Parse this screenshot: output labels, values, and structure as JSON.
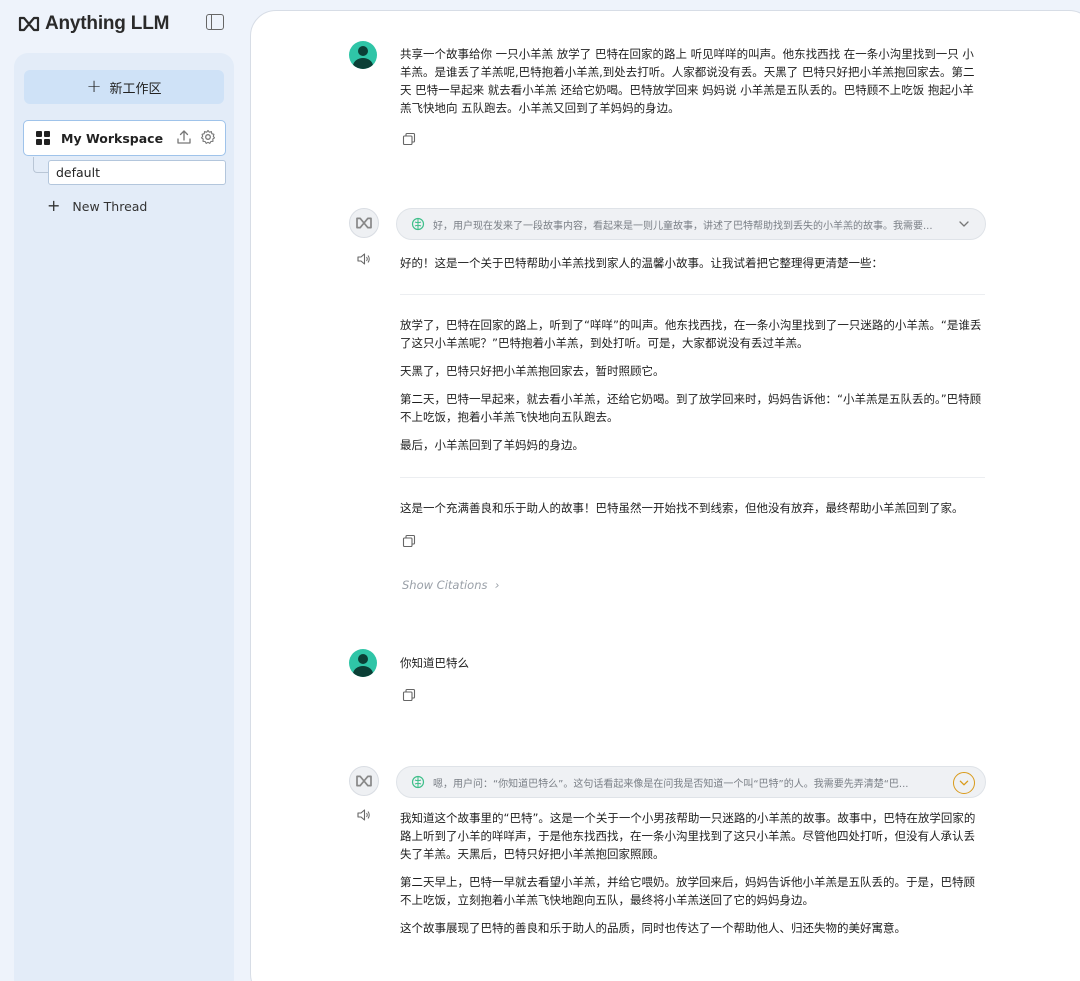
{
  "app": {
    "title": "Anything LLM",
    "brand_color": "#2a2a2a"
  },
  "sidebar": {
    "new_workspace_label": "新工作区",
    "workspace": {
      "label": "My Workspace",
      "icon": "grid-icon"
    },
    "thread": "default",
    "new_thread_label": "New Thread"
  },
  "chat": {
    "messages": [
      {
        "role": "user",
        "text": "共享一个故事给你 一只小羊羔 放学了 巴特在回家的路上 听见咩咩的叫声。他东找西找 在一条小沟里找到一只 小羊羔。是谁丢了羊羔呢,巴特抱着小羊羔,到处去打听。人家都说没有丢。天黑了 巴特只好把小羊羔抱回家去。第二天 巴特一早起来 就去看小羊羔 还给它奶喝。巴特放学回来 妈妈说 小羊羔是五队丢的。巴特顾不上吃饭 抱起小羊羔飞快地向 五队跑去。小羊羔又回到了羊妈妈的身边。"
      },
      {
        "role": "assistant",
        "thought": "好，用户现在发来了一段故事内容，看起来是一则儿童故事，讲述了巴特帮助找到丢失的小羊羔的故事。我需要...",
        "intro": "好的！这是一个关于巴特帮助小羊羔找到家人的温馨小故事。让我试着把它整理得更清楚一些：",
        "story": [
          "放学了，巴特在回家的路上，听到了“咩咩”的叫声。他东找西找，在一条小沟里找到了一只迷路的小羊羔。“是谁丢了这只小羊羔呢？”巴特抱着小羊羔，到处打听。可是，大家都说没有丢过羊羔。",
          "天黑了，巴特只好把小羊羔抱回家去，暂时照顾它。",
          "第二天，巴特一早起来，就去看小羊羔，还给它奶喝。到了放学回来时，妈妈告诉他：“小羊羔是五队丢的。”巴特顾不上吃饭，抱着小羊羔飞快地向五队跑去。",
          "最后，小羊羔回到了羊妈妈的身边。"
        ],
        "closing": "这是一个充满善良和乐于助人的故事！巴特虽然一开始找不到线索，但他没有放弃，最终帮助小羊羔回到了家。",
        "citations_label": "Show Citations"
      },
      {
        "role": "user",
        "text": "你知道巴特么"
      },
      {
        "role": "assistant",
        "thought": "嗯，用户问：“你知道巴特么”。这句话看起来像是在问我是否知道一个叫“巴特”的人。我需要先弄清楚“巴...",
        "paragraphs": [
          "我知道这个故事里的“巴特”。这是一个关于一个小男孩帮助一只迷路的小羊羔的故事。故事中，巴特在放学回家的路上听到了小羊的咩咩声，于是他东找西找，在一条小沟里找到了这只小羊羔。尽管他四处打听，但没有人承认丢失了羊羔。天黑后，巴特只好把小羊羔抱回家照顾。",
          "第二天早上，巴特一早就去看望小羊羔，并给它喂奶。放学回来后，妈妈告诉他小羊羔是五队丢的。于是，巴特顾不上吃饭，立刻抱着小羊羔飞快地跑向五队，最终将小羊羔送回了它的妈妈身边。",
          "这个故事展现了巴特的善良和乐于助人的品质，同时也传达了一个帮助他人、归还失物的美好寓意。"
        ]
      }
    ]
  },
  "colors": {
    "sidebar_bg": "#e3ecf8",
    "new_workspace_bg": "#cfe2f7",
    "user_avatar": "#2fc5a7",
    "active_chevron_ring": "#d99a1a"
  }
}
